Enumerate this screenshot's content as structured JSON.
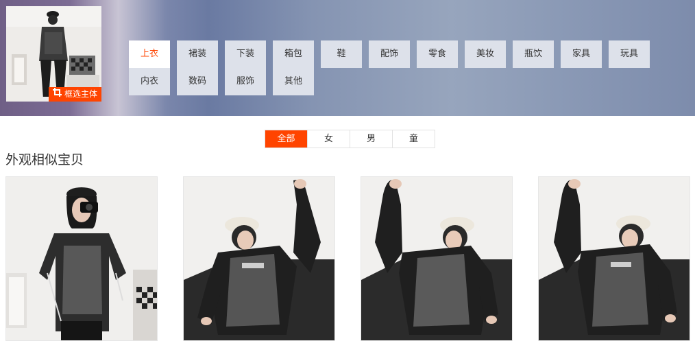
{
  "query_image": {
    "crop_label": "框选主体",
    "crop_icon": "crop-icon"
  },
  "categories": [
    {
      "label": "上衣",
      "active": true
    },
    {
      "label": "裙装"
    },
    {
      "label": "下装"
    },
    {
      "label": "箱包"
    },
    {
      "label": "鞋"
    },
    {
      "label": "配饰"
    },
    {
      "label": "零食"
    },
    {
      "label": "美妆"
    },
    {
      "label": "瓶饮"
    },
    {
      "label": "家具"
    },
    {
      "label": "玩具"
    },
    {
      "label": "内衣"
    },
    {
      "label": "数码"
    },
    {
      "label": "服饰"
    },
    {
      "label": "其他"
    }
  ],
  "gender_filters": [
    {
      "label": "全部",
      "active": true
    },
    {
      "label": "女"
    },
    {
      "label": "男"
    },
    {
      "label": "童"
    }
  ],
  "section_title": "外观相似宝贝",
  "colors": {
    "accent": "#ff4400",
    "category_bg": "#dde1ea"
  }
}
